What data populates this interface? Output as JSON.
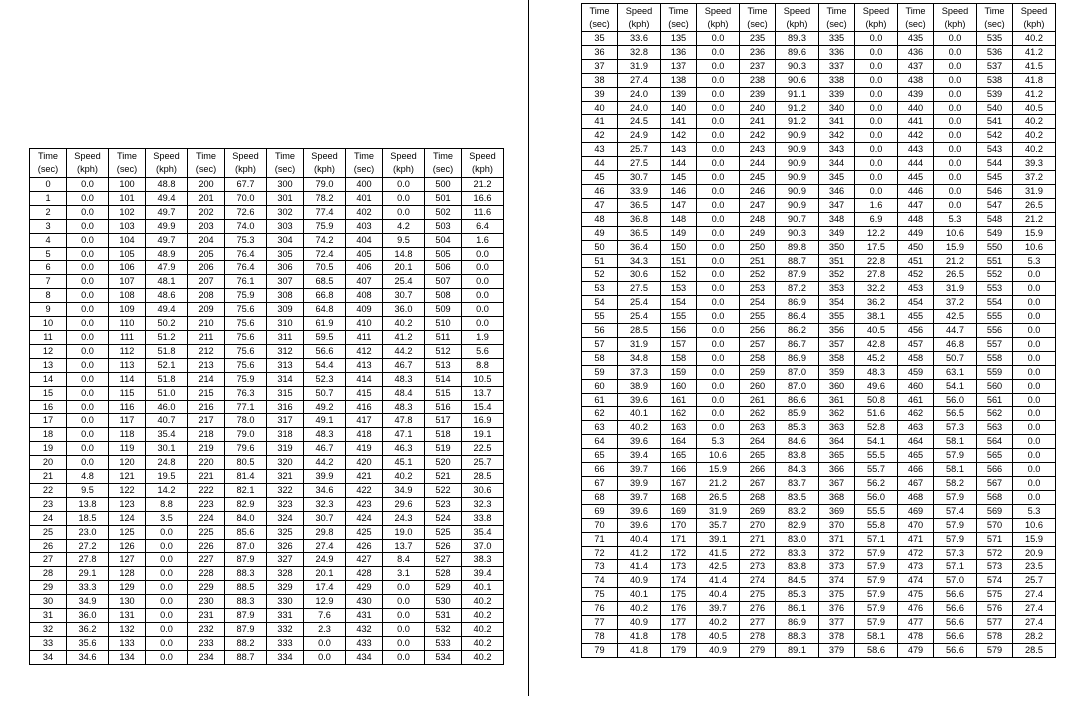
{
  "header": {
    "time": "Time",
    "time_unit": "(sec)",
    "speed": "Speed",
    "speed_unit": "(kph)"
  },
  "left_table": {
    "columns": [
      {
        "times": [
          "0",
          "1",
          "2",
          "3",
          "4",
          "5",
          "6",
          "7",
          "8",
          "9",
          "10",
          "11",
          "12",
          "13",
          "14",
          "15",
          "16",
          "17",
          "18",
          "19",
          "20",
          "21",
          "22",
          "23",
          "24",
          "25",
          "26",
          "27",
          "28",
          "29",
          "30",
          "31",
          "32",
          "33",
          "34"
        ],
        "speeds": [
          "0.0",
          "0.0",
          "0.0",
          "0.0",
          "0.0",
          "0.0",
          "0.0",
          "0.0",
          "0.0",
          "0.0",
          "0.0",
          "0.0",
          "0.0",
          "0.0",
          "0.0",
          "0.0",
          "0.0",
          "0.0",
          "0.0",
          "0.0",
          "0.0",
          "4.8",
          "9.5",
          "13.8",
          "18.5",
          "23.0",
          "27.2",
          "27.8",
          "29.1",
          "33.3",
          "34.9",
          "36.0",
          "36.2",
          "35.6",
          "34.6"
        ]
      },
      {
        "times": [
          "100",
          "101",
          "102",
          "103",
          "104",
          "105",
          "106",
          "107",
          "108",
          "109",
          "110",
          "111",
          "112",
          "113",
          "114",
          "115",
          "116",
          "117",
          "118",
          "119",
          "120",
          "121",
          "122",
          "123",
          "124",
          "125",
          "126",
          "127",
          "128",
          "129",
          "130",
          "131",
          "132",
          "133",
          "134"
        ],
        "speeds": [
          "48.8",
          "49.4",
          "49.7",
          "49.9",
          "49.7",
          "48.9",
          "47.9",
          "48.1",
          "48.6",
          "49.4",
          "50.2",
          "51.2",
          "51.8",
          "52.1",
          "51.8",
          "51.0",
          "46.0",
          "40.7",
          "35.4",
          "30.1",
          "24.8",
          "19.5",
          "14.2",
          "8.8",
          "3.5",
          "0.0",
          "0.0",
          "0.0",
          "0.0",
          "0.0",
          "0.0",
          "0.0",
          "0.0",
          "0.0",
          "0.0"
        ]
      },
      {
        "times": [
          "200",
          "201",
          "202",
          "203",
          "204",
          "205",
          "206",
          "207",
          "208",
          "209",
          "210",
          "211",
          "212",
          "213",
          "214",
          "215",
          "216",
          "217",
          "218",
          "219",
          "220",
          "221",
          "222",
          "223",
          "224",
          "225",
          "226",
          "227",
          "228",
          "229",
          "230",
          "231",
          "232",
          "233",
          "234"
        ],
        "speeds": [
          "67.7",
          "70.0",
          "72.6",
          "74.0",
          "75.3",
          "76.4",
          "76.4",
          "76.1",
          "75.9",
          "75.6",
          "75.6",
          "75.6",
          "75.6",
          "75.6",
          "75.9",
          "76.3",
          "77.1",
          "78.0",
          "79.0",
          "79.6",
          "80.5",
          "81.4",
          "82.1",
          "82.9",
          "84.0",
          "85.6",
          "87.0",
          "87.9",
          "88.3",
          "88.5",
          "88.3",
          "87.9",
          "87.9",
          "88.2",
          "88.7"
        ]
      },
      {
        "times": [
          "300",
          "301",
          "302",
          "303",
          "304",
          "305",
          "306",
          "307",
          "308",
          "309",
          "310",
          "311",
          "312",
          "313",
          "314",
          "315",
          "316",
          "317",
          "318",
          "319",
          "320",
          "321",
          "322",
          "323",
          "324",
          "325",
          "326",
          "327",
          "328",
          "329",
          "330",
          "331",
          "332",
          "333",
          "334"
        ],
        "speeds": [
          "79.0",
          "78.2",
          "77.4",
          "75.9",
          "74.2",
          "72.4",
          "70.5",
          "68.5",
          "66.8",
          "64.8",
          "61.9",
          "59.5",
          "56.6",
          "54.4",
          "52.3",
          "50.7",
          "49.2",
          "49.1",
          "48.3",
          "46.7",
          "44.2",
          "39.9",
          "34.6",
          "32.3",
          "30.7",
          "29.8",
          "27.4",
          "24.9",
          "20.1",
          "17.4",
          "12.9",
          "7.6",
          "2.3",
          "0.0",
          "0.0"
        ]
      },
      {
        "times": [
          "400",
          "401",
          "402",
          "403",
          "404",
          "405",
          "406",
          "407",
          "408",
          "409",
          "410",
          "411",
          "412",
          "413",
          "414",
          "415",
          "416",
          "417",
          "418",
          "419",
          "420",
          "421",
          "422",
          "423",
          "424",
          "425",
          "426",
          "427",
          "428",
          "429",
          "430",
          "431",
          "432",
          "433",
          "434"
        ],
        "speeds": [
          "0.0",
          "0.0",
          "0.0",
          "4.2",
          "9.5",
          "14.8",
          "20.1",
          "25.4",
          "30.7",
          "36.0",
          "40.2",
          "41.2",
          "44.2",
          "46.7",
          "48.3",
          "48.4",
          "48.3",
          "47.8",
          "47.1",
          "46.3",
          "45.1",
          "40.2",
          "34.9",
          "29.6",
          "24.3",
          "19.0",
          "13.7",
          "8.4",
          "3.1",
          "0.0",
          "0.0",
          "0.0",
          "0.0",
          "0.0",
          "0.0"
        ]
      },
      {
        "times": [
          "500",
          "501",
          "502",
          "503",
          "504",
          "505",
          "506",
          "507",
          "508",
          "509",
          "510",
          "511",
          "512",
          "513",
          "514",
          "515",
          "516",
          "517",
          "518",
          "519",
          "520",
          "521",
          "522",
          "523",
          "524",
          "525",
          "526",
          "527",
          "528",
          "529",
          "530",
          "531",
          "532",
          "533",
          "534"
        ],
        "speeds": [
          "21.2",
          "16.6",
          "11.6",
          "6.4",
          "1.6",
          "0.0",
          "0.0",
          "0.0",
          "0.0",
          "0.0",
          "0.0",
          "1.9",
          "5.6",
          "8.8",
          "10.5",
          "13.7",
          "15.4",
          "16.9",
          "19.1",
          "22.5",
          "25.7",
          "28.5",
          "30.6",
          "32.3",
          "33.8",
          "35.4",
          "37.0",
          "38.3",
          "39.4",
          "40.1",
          "40.2",
          "40.2",
          "40.2",
          "40.2",
          "40.2"
        ]
      }
    ]
  },
  "right_table": {
    "columns": [
      {
        "times": [
          "35",
          "36",
          "37",
          "38",
          "39",
          "40",
          "41",
          "42",
          "43",
          "44",
          "45",
          "46",
          "47",
          "48",
          "49",
          "50",
          "51",
          "52",
          "53",
          "54",
          "55",
          "56",
          "57",
          "58",
          "59",
          "60",
          "61",
          "62",
          "63",
          "64",
          "65",
          "66",
          "67",
          "68",
          "69",
          "70",
          "71",
          "72",
          "73",
          "74",
          "75",
          "76",
          "77",
          "78",
          "79"
        ],
        "speeds": [
          "33.6",
          "32.8",
          "31.9",
          "27.4",
          "24.0",
          "24.0",
          "24.5",
          "24.9",
          "25.7",
          "27.5",
          "30.7",
          "33.9",
          "36.5",
          "36.8",
          "36.5",
          "36.4",
          "34.3",
          "30.6",
          "27.5",
          "25.4",
          "25.4",
          "28.5",
          "31.9",
          "34.8",
          "37.3",
          "38.9",
          "39.6",
          "40.1",
          "40.2",
          "39.6",
          "39.4",
          "39.7",
          "39.9",
          "39.7",
          "39.6",
          "39.6",
          "40.4",
          "41.2",
          "41.4",
          "40.9",
          "40.1",
          "40.2",
          "40.9",
          "41.8",
          "41.8"
        ]
      },
      {
        "times": [
          "135",
          "136",
          "137",
          "138",
          "139",
          "140",
          "141",
          "142",
          "143",
          "144",
          "145",
          "146",
          "147",
          "148",
          "149",
          "150",
          "151",
          "152",
          "153",
          "154",
          "155",
          "156",
          "157",
          "158",
          "159",
          "160",
          "161",
          "162",
          "163",
          "164",
          "165",
          "166",
          "167",
          "168",
          "169",
          "170",
          "171",
          "172",
          "173",
          "174",
          "175",
          "176",
          "177",
          "178",
          "179"
        ],
        "speeds": [
          "0.0",
          "0.0",
          "0.0",
          "0.0",
          "0.0",
          "0.0",
          "0.0",
          "0.0",
          "0.0",
          "0.0",
          "0.0",
          "0.0",
          "0.0",
          "0.0",
          "0.0",
          "0.0",
          "0.0",
          "0.0",
          "0.0",
          "0.0",
          "0.0",
          "0.0",
          "0.0",
          "0.0",
          "0.0",
          "0.0",
          "0.0",
          "0.0",
          "0.0",
          "5.3",
          "10.6",
          "15.9",
          "21.2",
          "26.5",
          "31.9",
          "35.7",
          "39.1",
          "41.5",
          "42.5",
          "41.4",
          "40.4",
          "39.7",
          "40.2",
          "40.5",
          "40.9"
        ]
      },
      {
        "times": [
          "235",
          "236",
          "237",
          "238",
          "239",
          "240",
          "241",
          "242",
          "243",
          "244",
          "245",
          "246",
          "247",
          "248",
          "249",
          "250",
          "251",
          "252",
          "253",
          "254",
          "255",
          "256",
          "257",
          "258",
          "259",
          "260",
          "261",
          "262",
          "263",
          "264",
          "265",
          "266",
          "267",
          "268",
          "269",
          "270",
          "271",
          "272",
          "273",
          "274",
          "275",
          "276",
          "277",
          "278",
          "279"
        ],
        "speeds": [
          "89.3",
          "89.6",
          "90.3",
          "90.6",
          "91.1",
          "91.2",
          "91.2",
          "90.9",
          "90.9",
          "90.9",
          "90.9",
          "90.9",
          "90.9",
          "90.7",
          "90.3",
          "89.8",
          "88.7",
          "87.9",
          "87.2",
          "86.9",
          "86.4",
          "86.2",
          "86.7",
          "86.9",
          "87.0",
          "87.0",
          "86.6",
          "85.9",
          "85.3",
          "84.6",
          "83.8",
          "84.3",
          "83.7",
          "83.5",
          "83.2",
          "82.9",
          "83.0",
          "83.3",
          "83.8",
          "84.5",
          "85.3",
          "86.1",
          "86.9",
          "88.3",
          "89.1"
        ]
      },
      {
        "times": [
          "335",
          "336",
          "337",
          "338",
          "339",
          "340",
          "341",
          "342",
          "343",
          "344",
          "345",
          "346",
          "347",
          "348",
          "349",
          "350",
          "351",
          "352",
          "353",
          "354",
          "355",
          "356",
          "357",
          "358",
          "359",
          "360",
          "361",
          "362",
          "363",
          "364",
          "365",
          "366",
          "367",
          "368",
          "369",
          "370",
          "371",
          "372",
          "373",
          "374",
          "375",
          "376",
          "377",
          "378",
          "379"
        ],
        "speeds": [
          "0.0",
          "0.0",
          "0.0",
          "0.0",
          "0.0",
          "0.0",
          "0.0",
          "0.0",
          "0.0",
          "0.0",
          "0.0",
          "0.0",
          "1.6",
          "6.9",
          "12.2",
          "17.5",
          "22.8",
          "27.8",
          "32.2",
          "36.2",
          "38.1",
          "40.5",
          "42.8",
          "45.2",
          "48.3",
          "49.6",
          "50.8",
          "51.6",
          "52.8",
          "54.1",
          "55.5",
          "55.7",
          "56.2",
          "56.0",
          "55.5",
          "55.8",
          "57.1",
          "57.9",
          "57.9",
          "57.9",
          "57.9",
          "57.9",
          "57.9",
          "58.1",
          "58.6"
        ]
      },
      {
        "times": [
          "435",
          "436",
          "437",
          "438",
          "439",
          "440",
          "441",
          "442",
          "443",
          "444",
          "445",
          "446",
          "447",
          "448",
          "449",
          "450",
          "451",
          "452",
          "453",
          "454",
          "455",
          "456",
          "457",
          "458",
          "459",
          "460",
          "461",
          "462",
          "463",
          "464",
          "465",
          "466",
          "467",
          "468",
          "469",
          "470",
          "471",
          "472",
          "473",
          "474",
          "475",
          "476",
          "477",
          "478",
          "479"
        ],
        "speeds": [
          "0.0",
          "0.0",
          "0.0",
          "0.0",
          "0.0",
          "0.0",
          "0.0",
          "0.0",
          "0.0",
          "0.0",
          "0.0",
          "0.0",
          "0.0",
          "5.3",
          "10.6",
          "15.9",
          "21.2",
          "26.5",
          "31.9",
          "37.2",
          "42.5",
          "44.7",
          "46.8",
          "50.7",
          "63.1",
          "54.1",
          "56.0",
          "56.5",
          "57.3",
          "58.1",
          "57.9",
          "58.1",
          "58.2",
          "57.9",
          "57.4",
          "57.9",
          "57.9",
          "57.3",
          "57.1",
          "57.0",
          "56.6",
          "56.6",
          "56.6",
          "56.6",
          "56.6"
        ]
      },
      {
        "times": [
          "535",
          "536",
          "537",
          "538",
          "539",
          "540",
          "541",
          "542",
          "543",
          "544",
          "545",
          "546",
          "547",
          "548",
          "549",
          "550",
          "551",
          "552",
          "553",
          "554",
          "555",
          "556",
          "557",
          "558",
          "559",
          "560",
          "561",
          "562",
          "563",
          "564",
          "565",
          "566",
          "567",
          "568",
          "569",
          "570",
          "571",
          "572",
          "573",
          "574",
          "575",
          "576",
          "577",
          "578",
          "579"
        ],
        "speeds": [
          "40.2",
          "41.2",
          "41.5",
          "41.8",
          "41.2",
          "40.5",
          "40.2",
          "40.2",
          "40.2",
          "39.3",
          "37.2",
          "31.9",
          "26.5",
          "21.2",
          "15.9",
          "10.6",
          "5.3",
          "0.0",
          "0.0",
          "0.0",
          "0.0",
          "0.0",
          "0.0",
          "0.0",
          "0.0",
          "0.0",
          "0.0",
          "0.0",
          "0.0",
          "0.0",
          "0.0",
          "0.0",
          "0.0",
          "0.0",
          "5.3",
          "10.6",
          "15.9",
          "20.9",
          "23.5",
          "25.7",
          "27.4",
          "27.4",
          "27.4",
          "28.2",
          "28.5"
        ]
      }
    ]
  }
}
